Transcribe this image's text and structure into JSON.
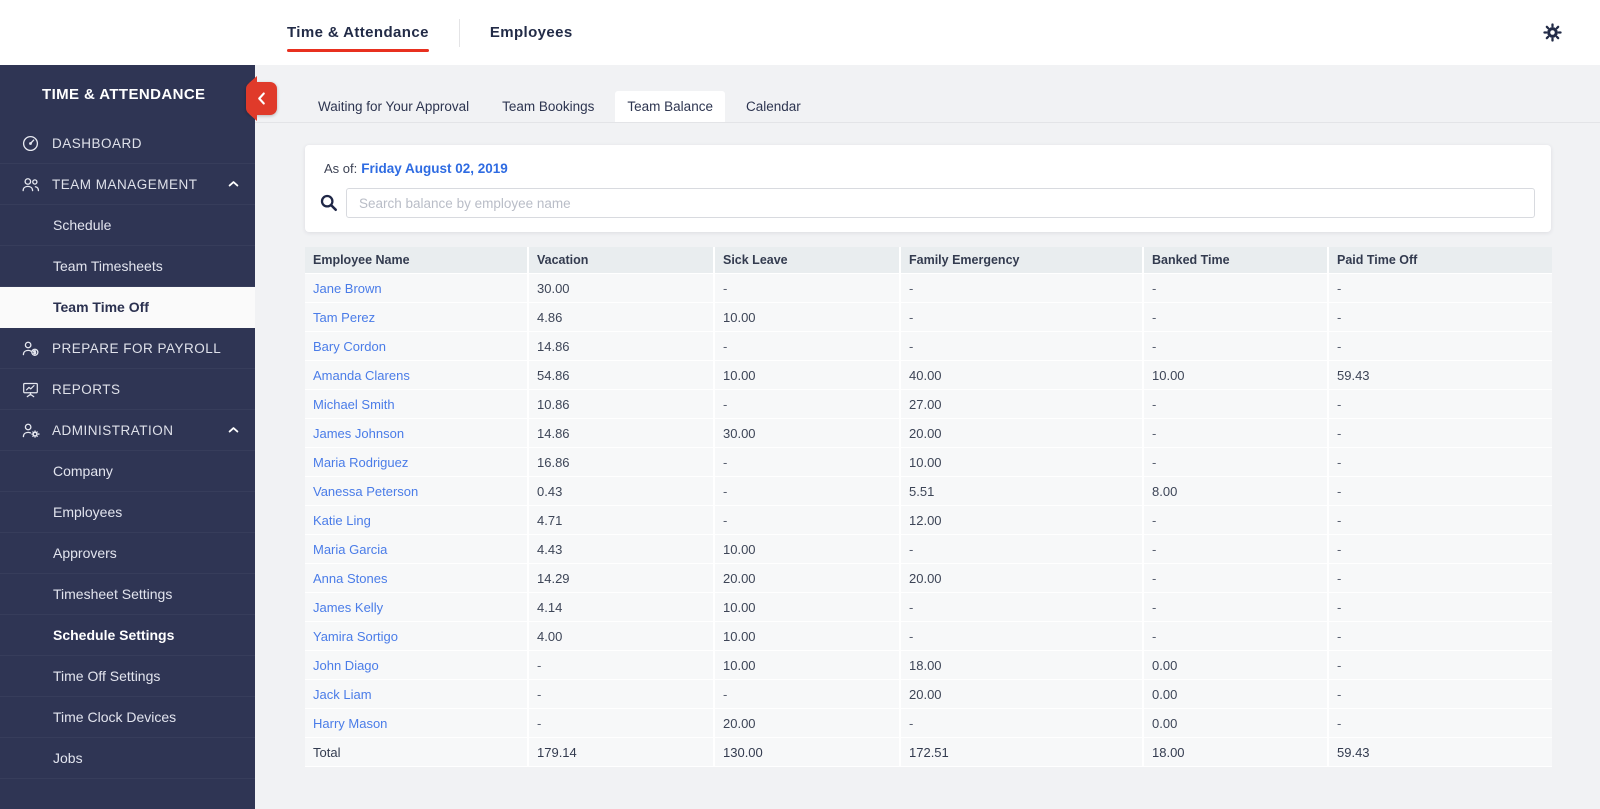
{
  "topbar": {
    "tabs": [
      {
        "label": "Time & Attendance",
        "active": true
      },
      {
        "label": "Employees",
        "active": false
      }
    ],
    "gear_icon": "gear-icon"
  },
  "sidebar": {
    "title": "TIME & ATTENDANCE",
    "collapse_icon": "chevron-left-icon",
    "items": [
      {
        "label": "DASHBOARD",
        "type": "top",
        "icon": "dashboard-icon"
      },
      {
        "label": "TEAM MANAGEMENT",
        "type": "top",
        "icon": "team-icon",
        "expanded": true
      },
      {
        "label": "Schedule",
        "type": "sub"
      },
      {
        "label": "Team Timesheets",
        "type": "sub"
      },
      {
        "label": "Team Time Off",
        "type": "sub",
        "active": true
      },
      {
        "label": "PREPARE FOR PAYROLL",
        "type": "top",
        "icon": "payroll-icon"
      },
      {
        "label": "REPORTS",
        "type": "top",
        "icon": "reports-icon"
      },
      {
        "label": "ADMINISTRATION",
        "type": "top",
        "icon": "administration-icon",
        "expanded": true
      },
      {
        "label": "Company",
        "type": "sub"
      },
      {
        "label": "Employees",
        "type": "sub"
      },
      {
        "label": "Approvers",
        "type": "sub"
      },
      {
        "label": "Timesheet Settings",
        "type": "sub"
      },
      {
        "label": "Schedule Settings",
        "type": "sub",
        "bold": true
      },
      {
        "label": "Time Off Settings",
        "type": "sub"
      },
      {
        "label": "Time Clock Devices",
        "type": "sub"
      },
      {
        "label": "Jobs",
        "type": "sub"
      }
    ]
  },
  "subtabs": {
    "tabs": [
      {
        "label": "Waiting for Your Approval",
        "active": false
      },
      {
        "label": "Team Bookings",
        "active": false
      },
      {
        "label": "Team Balance",
        "active": true
      },
      {
        "label": "Calendar",
        "active": false
      }
    ]
  },
  "filter": {
    "as_of_label": "As of:",
    "as_of_date": "Friday August 02, 2019",
    "search_icon": "search-icon",
    "search_placeholder": "Search balance by employee name"
  },
  "table": {
    "columns": [
      "Employee Name",
      "Vacation",
      "Sick Leave",
      "Family Emergency",
      "Banked Time",
      "Paid Time Off"
    ],
    "rows": [
      [
        "Jane Brown",
        "30.00",
        "-",
        "-",
        "-",
        "-"
      ],
      [
        "Tam Perez",
        "4.86",
        "10.00",
        "-",
        "-",
        "-"
      ],
      [
        "Bary Cordon",
        "14.86",
        "-",
        "-",
        "-",
        "-"
      ],
      [
        "Amanda Clarens",
        "54.86",
        "10.00",
        "40.00",
        "10.00",
        "59.43"
      ],
      [
        "Michael Smith",
        "10.86",
        "-",
        "27.00",
        "-",
        "-"
      ],
      [
        "James Johnson",
        "14.86",
        "30.00",
        "20.00",
        "-",
        "-"
      ],
      [
        "Maria Rodriguez",
        "16.86",
        "-",
        "10.00",
        "-",
        "-"
      ],
      [
        "Vanessa Peterson",
        "0.43",
        "-",
        "5.51",
        "8.00",
        "-"
      ],
      [
        "Katie Ling",
        "4.71",
        "-",
        "12.00",
        "-",
        "-"
      ],
      [
        "Maria Garcia",
        "4.43",
        "10.00",
        "-",
        "-",
        "-"
      ],
      [
        "Anna Stones",
        "14.29",
        "20.00",
        "20.00",
        "-",
        "-"
      ],
      [
        "James Kelly",
        "4.14",
        "10.00",
        "-",
        "-",
        "-"
      ],
      [
        "Yamira Sortigo",
        "4.00",
        "10.00",
        "-",
        "-",
        "-"
      ],
      [
        "John Diago",
        "-",
        "10.00",
        "18.00",
        "0.00",
        "-"
      ],
      [
        "Jack Liam",
        "-",
        "-",
        "20.00",
        "0.00",
        "-"
      ],
      [
        "Harry Mason",
        "-",
        "20.00",
        "-",
        "0.00",
        "-"
      ]
    ],
    "total_row": [
      "Total",
      "179.14",
      "130.00",
      "172.51",
      "18.00",
      "59.43"
    ]
  },
  "colors": {
    "accent_red": "#e8301f",
    "sidebar_navy": "#2f3554",
    "link_blue": "#2e6be2",
    "employee_name_blue": "#4a7ce8",
    "table_header_bg": "#e9edef",
    "table_row_bg": "#f7f8f9",
    "main_bg": "#f1f2f4"
  }
}
